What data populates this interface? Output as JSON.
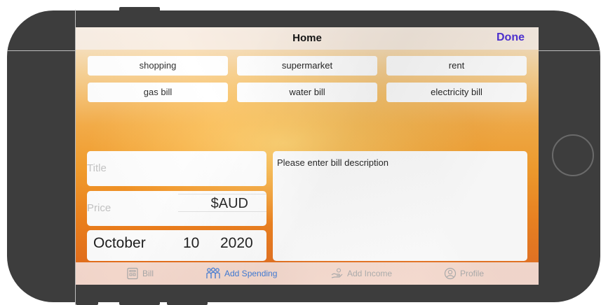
{
  "navbar": {
    "title": "Home",
    "done_label": "Done"
  },
  "categories": [
    "shopping",
    "supermarket",
    "rent",
    "gas bill",
    "water bill",
    "electricity bill"
  ],
  "form": {
    "title_placeholder": "Title",
    "price_placeholder": "Price",
    "currency": "$AUD",
    "description": "Please enter bill description",
    "date": {
      "month": "October",
      "day": "10",
      "year": "2020"
    }
  },
  "tabs": [
    {
      "label": "Bill",
      "icon": "bill-icon",
      "active": false
    },
    {
      "label": "Add Spending",
      "icon": "add-spending-icon",
      "active": true
    },
    {
      "label": "Add Income",
      "icon": "add-income-icon",
      "active": false
    },
    {
      "label": "Profile",
      "icon": "profile-icon",
      "active": false
    }
  ],
  "colors": {
    "accent": "#4a2bd6",
    "active_tab": "#3a78d8",
    "inactive_tab": "#a9a9a9"
  }
}
